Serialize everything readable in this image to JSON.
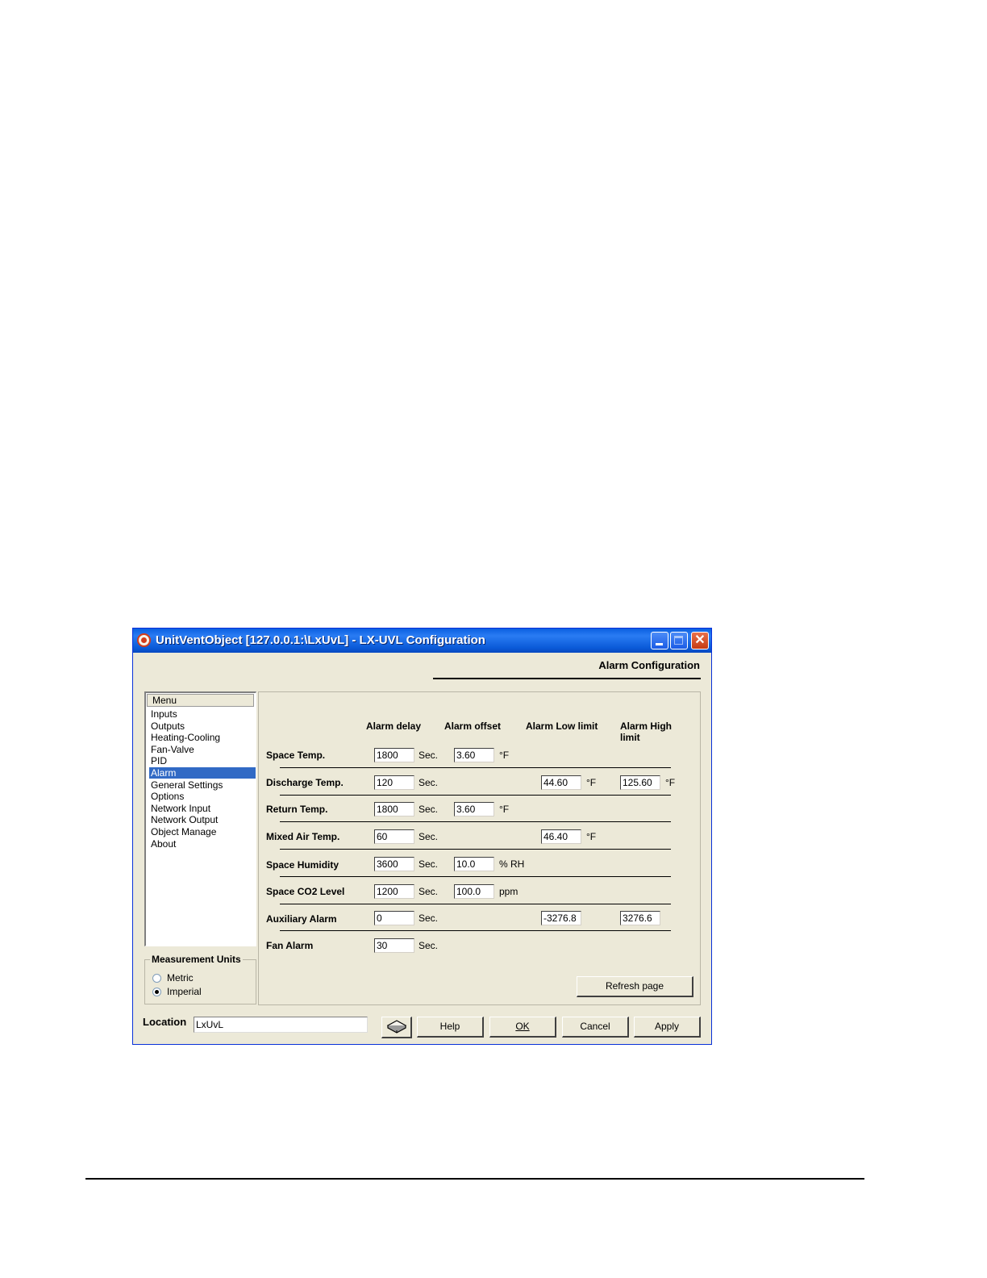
{
  "window": {
    "title": "UnitVentObject  [127.0.0.1:\\LxUvL] - LX-UVL Configuration",
    "icons": [
      "app-icon",
      "minimize-icon",
      "maximize-icon",
      "close-icon"
    ]
  },
  "heading": "Alarm Configuration",
  "menu": {
    "header": "Menu",
    "items": [
      "Inputs",
      "Outputs",
      "Heating-Cooling",
      "Fan-Valve",
      "PID",
      "Alarm",
      "General Settings",
      "Options",
      "Network Input",
      "Network Output",
      "Object Manage",
      "About"
    ],
    "selected": "Alarm"
  },
  "units": {
    "legend": "Measurement Units",
    "options": [
      "Metric",
      "Imperial"
    ],
    "selected": "Imperial"
  },
  "columns": {
    "delay": "Alarm delay",
    "offset": "Alarm offset",
    "low": "Alarm Low limit",
    "high_line1": "Alarm High",
    "high_line2": "limit"
  },
  "rows": [
    {
      "label": "Space Temp.",
      "delay": "1800",
      "delay_unit": "Sec.",
      "offset": "3.60",
      "offset_unit": "°F"
    },
    {
      "label": "Discharge Temp.",
      "delay": "120",
      "delay_unit": "Sec.",
      "low": "44.60",
      "low_unit": "°F",
      "high": "125.60",
      "high_unit": "°F"
    },
    {
      "label": "Return Temp.",
      "delay": "1800",
      "delay_unit": "Sec.",
      "offset": "3.60",
      "offset_unit": "°F"
    },
    {
      "label": "Mixed Air Temp.",
      "delay": "60",
      "delay_unit": "Sec.",
      "low": "46.40",
      "low_unit": "°F"
    },
    {
      "label": "Space Humidity",
      "delay": "3600",
      "delay_unit": "Sec.",
      "offset": "10.0",
      "offset_unit": "% RH"
    },
    {
      "label": "Space CO2 Level",
      "delay": "1200",
      "delay_unit": "Sec.",
      "offset": "100.0",
      "offset_unit": "ppm"
    },
    {
      "label": "Auxiliary Alarm",
      "delay": "0",
      "delay_unit": "Sec.",
      "low": "-3276.8",
      "high": "3276.6"
    },
    {
      "label": "Fan Alarm",
      "delay": "30",
      "delay_unit": "Sec."
    }
  ],
  "buttons": {
    "refresh": "Refresh page",
    "help": "Help",
    "ok": "OK",
    "cancel": "Cancel",
    "apply": "Apply",
    "book_icon": "book-icon"
  },
  "location": {
    "label": "Location",
    "value": "LxUvL"
  }
}
